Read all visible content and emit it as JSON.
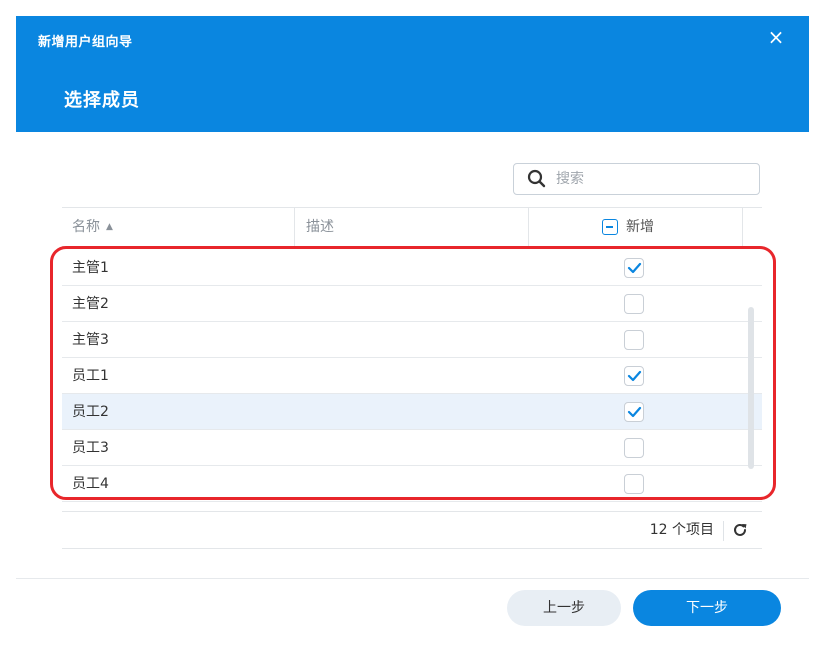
{
  "header": {
    "wizard_title": "新增用户组向导",
    "step_title": "选择成员",
    "close_symbol": "×",
    "bg_color": "#0a86e0"
  },
  "search": {
    "placeholder": "搜索",
    "icon": "search-icon"
  },
  "table": {
    "columns": {
      "name": "名称",
      "name_sort": "ascending",
      "description": "描述",
      "add": "新增",
      "add_header_state": "indeterminate"
    },
    "rows": [
      {
        "name": "主管1",
        "description": "",
        "checked": true,
        "selected": false
      },
      {
        "name": "主管2",
        "description": "",
        "checked": false,
        "selected": false
      },
      {
        "name": "主管3",
        "description": "",
        "checked": false,
        "selected": false
      },
      {
        "name": "员工1",
        "description": "",
        "checked": true,
        "selected": false
      },
      {
        "name": "员工2",
        "description": "",
        "checked": true,
        "selected": true
      },
      {
        "name": "员工3",
        "description": "",
        "checked": false,
        "selected": false
      },
      {
        "name": "员工4",
        "description": "",
        "checked": false,
        "selected": false
      }
    ],
    "footer": {
      "count_text": "12 个项目",
      "refresh_icon": "refresh-icon"
    }
  },
  "buttons": {
    "prev": "上一步",
    "next": "下一步"
  },
  "colors": {
    "accent": "#0a86e0",
    "highlight_border": "#e8262b",
    "row_selected": "#eaf2fb"
  }
}
